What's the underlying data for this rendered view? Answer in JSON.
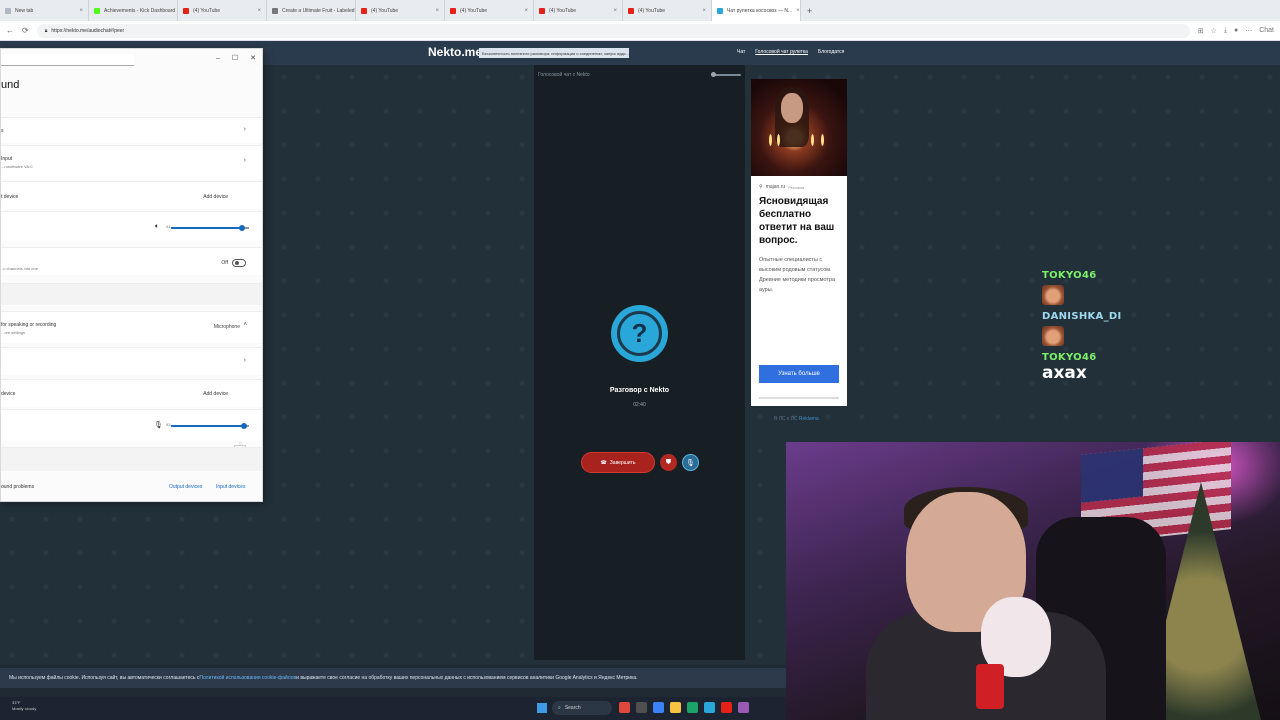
{
  "browser": {
    "tabs": [
      {
        "label": "New tab",
        "color": "#b0b8c4"
      },
      {
        "label": "Achievements - Kick Dashboard",
        "color": "#53fc18"
      },
      {
        "label": "(4) YouTube",
        "color": "#e62117"
      },
      {
        "label": "Create a Ultimate Fruit - Labeled",
        "color": "#777777"
      },
      {
        "label": "(4) YouTube",
        "color": "#e62117"
      },
      {
        "label": "(4) YouTube",
        "color": "#e62117"
      },
      {
        "label": "(4) YouTube",
        "color": "#e62117"
      },
      {
        "label": "(4) YouTube",
        "color": "#e62117"
      },
      {
        "label": "Чат рулетка кососвоз — N...",
        "color": "#2aa7d9",
        "active": true
      }
    ],
    "url": "https://nekto.me/audiochat#/peer",
    "new_tab_glyph": "+",
    "chat_button": "Chat"
  },
  "site": {
    "logo": "Nekto.me",
    "notice": "Бесконечность полезного разговора: информация о соединении, запуск ауди...",
    "nav": [
      "Чат",
      "Голосовой чат рулетка",
      "Блогодатся"
    ]
  },
  "chat_panel": {
    "header": "Голосовой чат с Nekto",
    "avatar_glyph": "?",
    "title": "Разговор с Nekto",
    "timer": "02:40",
    "end_button": "Завершить"
  },
  "ad": {
    "source": "majan.ru",
    "source_tag": "Реклама",
    "title": "Ясновидящая бесплатно ответит на ваш вопрос.",
    "text": "Опытные специалисты с высоким родовым статусом. Древние методики просмотра ауры.",
    "button": "Узнать больше",
    "footer_prefix": "В ЛС к ЛС",
    "footer_link": "Reklama"
  },
  "settings": {
    "heading": "und",
    "rows": {
      "output_label": "s",
      "input_title": "Input",
      "input_sub": "...rosoftware VA:0",
      "add_output_label": "t device",
      "add_output_action": "Add device",
      "output_volume": 91,
      "mono_label": "..o channels into one",
      "mono_value": "Off",
      "mic_label": "for speaking or recording",
      "mic_sub": "...ore settings",
      "mic_collapse": "Microphone",
      "add_input_label": "device",
      "add_input_action": "Add device",
      "input_volume": 93,
      "input_tooltip": "93"
    },
    "footer": {
      "left": "ound problems",
      "output_link": "Output devices",
      "input_link": "Input devices"
    }
  },
  "stream_chat": {
    "messages": [
      {
        "user": "TOKYO46",
        "color": "#7cf068",
        "type": "emote"
      },
      {
        "user": "DANISHKA_DI",
        "color": "#9fd8ee",
        "type": "emote"
      },
      {
        "user": "TOKYO46",
        "color": "#7cf068",
        "type": "text",
        "text": "axax"
      }
    ]
  },
  "cookie_bar": {
    "text_before": "Мы используем файлы cookie. Используя сайт, вы автоматически соглашаетесь с ",
    "link": "Политикой использования cookie-файлов",
    "text_after": " и выражаете свое согласие на обработку ваших персональных данных с использованием сервисов аналитики Google Analytics и Яндекс Метрика."
  },
  "taskbar": {
    "temp": "33°F",
    "weather": "Mostly cloudy",
    "search": "Search",
    "app_colors": [
      "#e0483e",
      "#4f4f4f",
      "#3b82f6",
      "#f6c343",
      "#1ba36a",
      "#2aa7d9",
      "#e62117",
      "#9b59b6"
    ]
  }
}
